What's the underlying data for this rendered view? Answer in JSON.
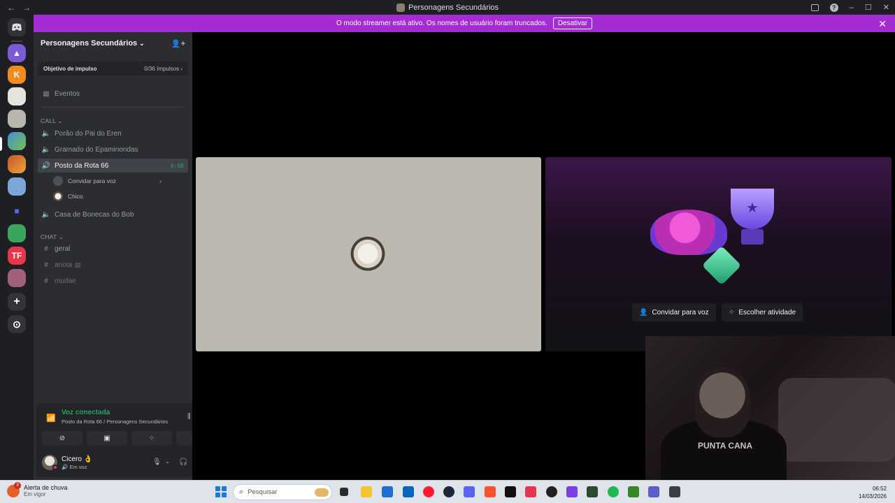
{
  "window": {
    "title": "Personagens Secundários",
    "nav_back": "←",
    "nav_forward": "→",
    "help_label": "?",
    "minimize": "–",
    "maximize": "☐",
    "close": "✕"
  },
  "banner": {
    "message": "O modo streamer está ativo. Os nomes de usuário foram truncados.",
    "button": "Desativar",
    "close": "✕"
  },
  "rail": {
    "home_icon": "discord-icon",
    "servers": [
      {
        "icon": "triangle-server",
        "color": "#7b5bd6"
      },
      {
        "icon": "k-server",
        "color": "#f08c1e"
      },
      {
        "icon": "face-server",
        "color": "#e6e3dd"
      },
      {
        "icon": "dog-server",
        "color": "#b9b6ad"
      },
      {
        "icon": "game-server",
        "color": "#4a8fd9"
      },
      {
        "icon": "fire-server",
        "color": "#c15a24"
      },
      {
        "icon": "avatar-server",
        "color": "#7aa6d8"
      },
      {
        "icon": "folder-server",
        "color": "#5865f2"
      },
      {
        "icon": "plant-server",
        "color": "#3ba55d"
      },
      {
        "icon": "tf-server",
        "color": "#e8364a"
      },
      {
        "icon": "anime-server",
        "color": "#a0607a"
      }
    ],
    "add_label": "+",
    "explore_label": "⊙"
  },
  "sidebar": {
    "guild_name": "Personagens Secundários",
    "boost_label": "Objetivo de impulso",
    "boost_value": "0/36 Impulsos",
    "events": "Eventos",
    "call_category": "CALL",
    "voice_channels": [
      {
        "name": "Porão do Pai do Eren"
      },
      {
        "name": "Gramado do Epaminondas"
      },
      {
        "name": "Posto da Rota 66",
        "timer": "0:08"
      }
    ],
    "invite_voice": "Convidar para voz",
    "member": "Chico",
    "last_voice": "Casa de Bonecas do Bob",
    "chat_category": "CHAT",
    "text_channels": [
      "geral",
      "anota",
      "mudae"
    ]
  },
  "voice_panel": {
    "status": "Voz conectada",
    "location": "Posto da Rota 66 / Personagens Secundários",
    "user_name": "Cicero",
    "user_emoji": "👌",
    "user_state": "Em voz"
  },
  "stage": {
    "invite_button": "Convidar para voz",
    "activity_button": "Escolher atividade",
    "shirt_text": "PUNTA CANA"
  },
  "taskbar": {
    "weather_title": "Alerta de chuva",
    "weather_sub": "Em vigor",
    "weather_badge": "3",
    "search_placeholder": "Pesquisar",
    "time": "06:52",
    "date": "14/03/2026"
  }
}
